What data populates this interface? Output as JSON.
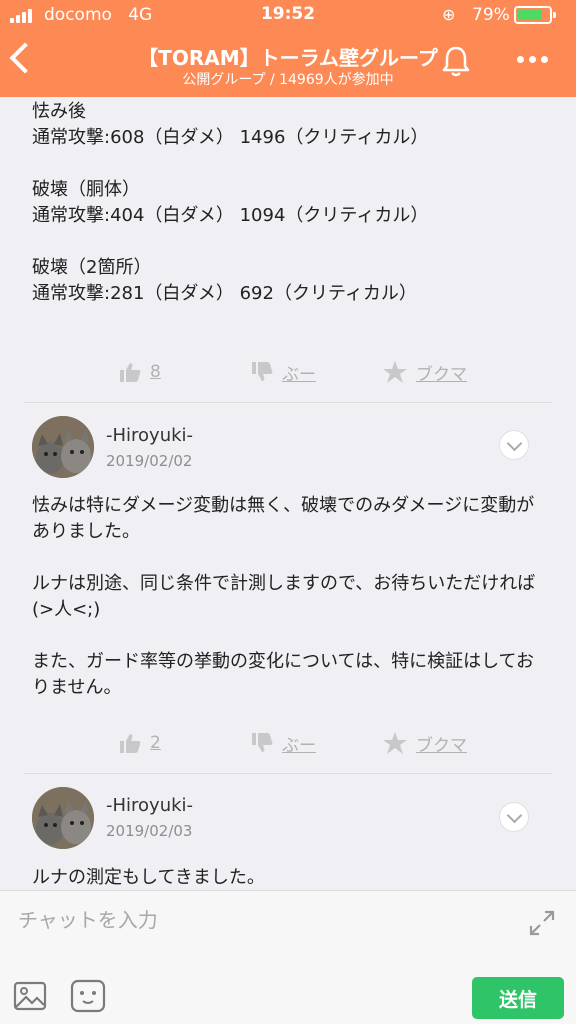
{
  "status_bar": {
    "carrier": "docomo",
    "network": "4G",
    "time": "19:52",
    "battery": "79%",
    "battery_level": 0.79,
    "battery_color": "#4cd964"
  },
  "header": {
    "title": "【TORAM】トーラム壁グループ",
    "subtitle": "公開グループ / 14969人が参加中",
    "back_icon": "chevron-left-icon",
    "bell_icon": "bell-icon",
    "more_icon": "more-dots-icon",
    "color": "#fd8a55"
  },
  "posts": [
    {
      "body": "怯み後\n通常攻撃:608（白ダメ） 1496（クリティカル）\n\n破壊（胴体）\n通常攻撃:404（白ダメ） 1094（クリティカル）\n\n破壊（2箇所）\n通常攻撃:281（白ダメ） 692（クリティカル）",
      "likes": "8",
      "boo": "ぶー",
      "bookmark": "ブクマ"
    },
    {
      "author": "-Hiroyuki-",
      "date": "2019/02/02",
      "body": "怯みは特にダメージ変動は無く、破壊でのみダメージに変動がありました。\n\nルナは別途、同じ条件で計測しますので、お待ちいただければ(>人<;)\n\nまた、ガード率等の挙動の変化については、特に検証はしておりません。",
      "likes": "2",
      "boo": "ぶー",
      "bookmark": "ブクマ"
    },
    {
      "author": "-Hiroyuki-",
      "date": "2019/02/03",
      "body": "ルナの測定もしてきました。"
    }
  ],
  "input_bar": {
    "placeholder": "チャットを入力",
    "send_label": "送信",
    "send_color": "#2ec467"
  }
}
